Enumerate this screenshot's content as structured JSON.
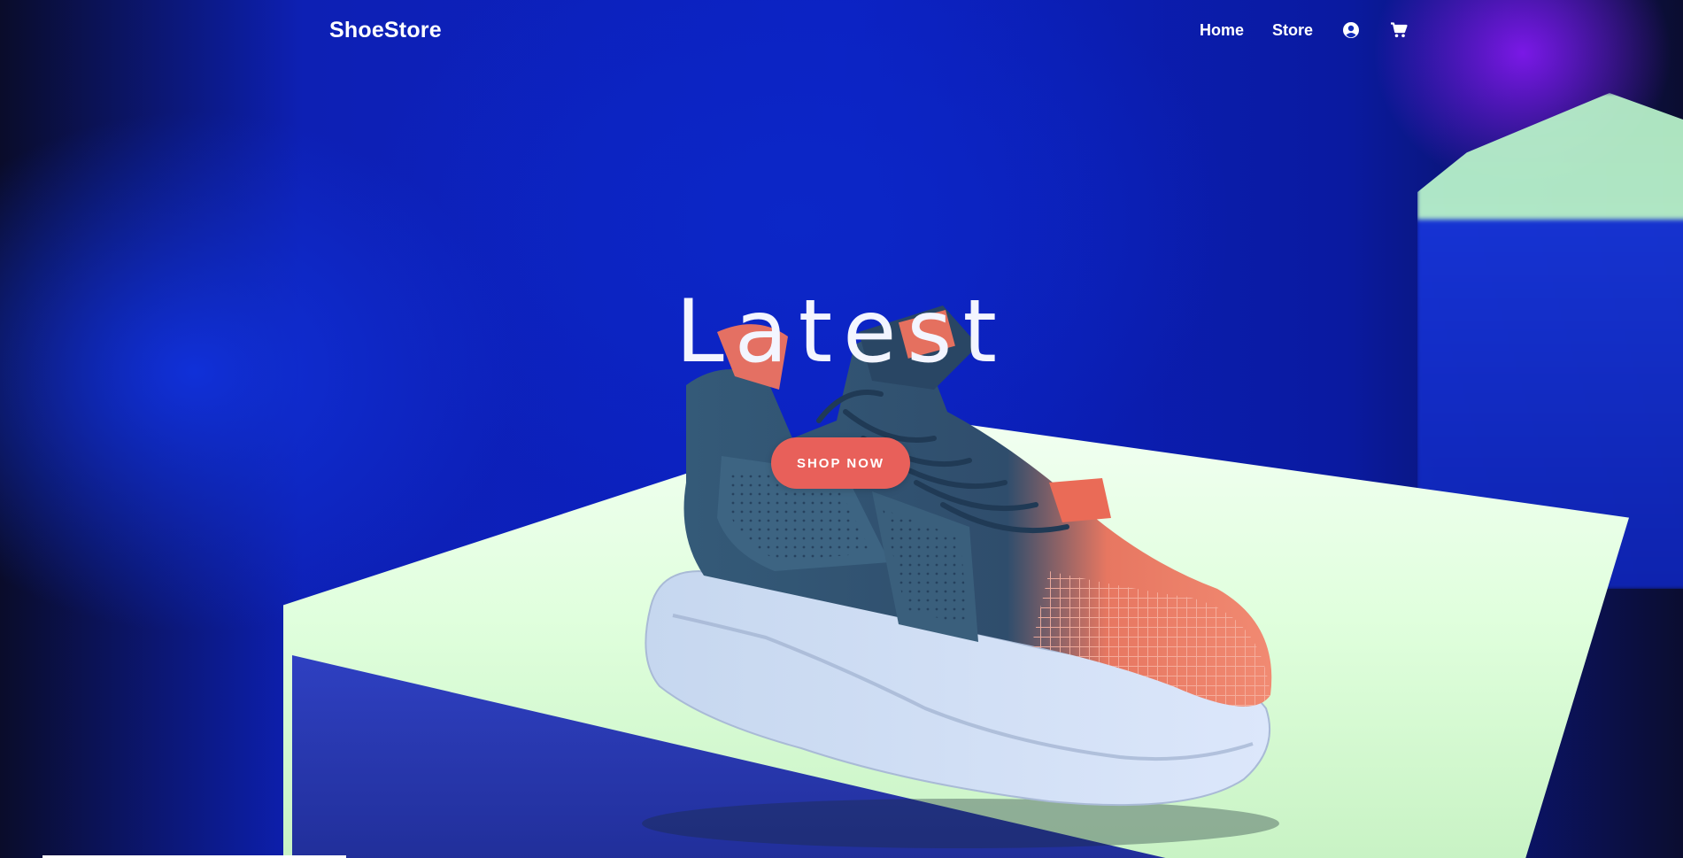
{
  "header": {
    "brand": "ShoeStore",
    "nav_links": [
      {
        "label": "Home"
      },
      {
        "label": "Store"
      }
    ],
    "icons": [
      "user-circle-icon",
      "cart-icon"
    ]
  },
  "hero": {
    "title": "Latest",
    "cta_label": "SHOP NOW"
  },
  "theme": {
    "accent": "#e8605a",
    "background_blue": "#0c21c3",
    "text": "#ffffff"
  }
}
